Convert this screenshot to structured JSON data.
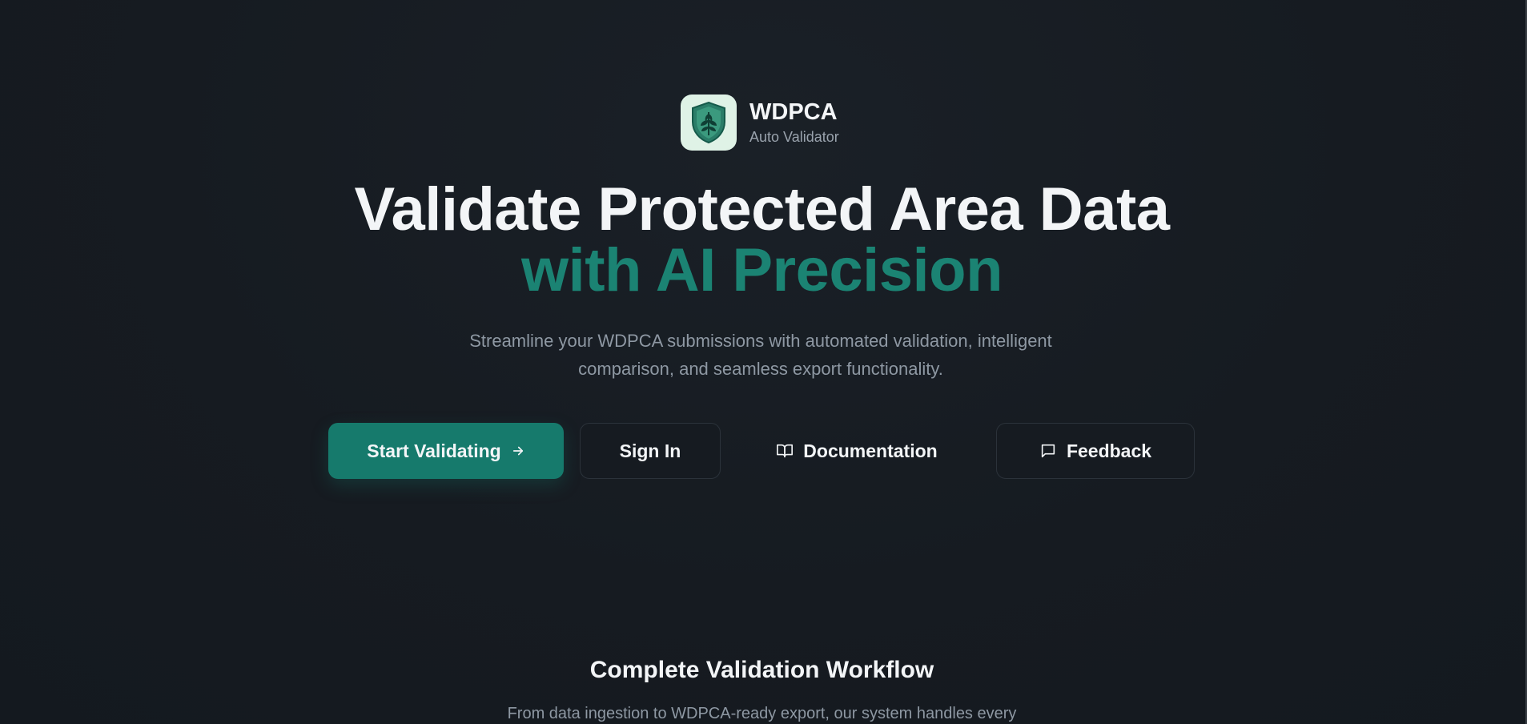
{
  "brand": {
    "name": "WDPCA",
    "subtitle": "Auto Validator",
    "logo_icon": "shield-leaf-icon"
  },
  "hero": {
    "title_line1": "Validate Protected Area Data",
    "title_line2": "with AI Precision",
    "description": "Streamline your WDPCA submissions with automated validation, intelligent comparison, and seamless export functionality."
  },
  "actions": {
    "start_validating": "Start Validating",
    "sign_in": "Sign In",
    "documentation": "Documentation",
    "feedback": "Feedback"
  },
  "icons": {
    "start_validating": "arrow-right-icon",
    "documentation": "book-open-icon",
    "feedback": "message-square-icon"
  },
  "workflow": {
    "title": "Complete Validation Workflow",
    "description": "From data ingestion to WDPCA-ready export, our system handles every"
  },
  "colors": {
    "background": "#161b21",
    "accent": "#1b8373",
    "primary_button": "#167a6c",
    "muted_text": "#8e98a3",
    "logo_background": "#dff2e6"
  }
}
